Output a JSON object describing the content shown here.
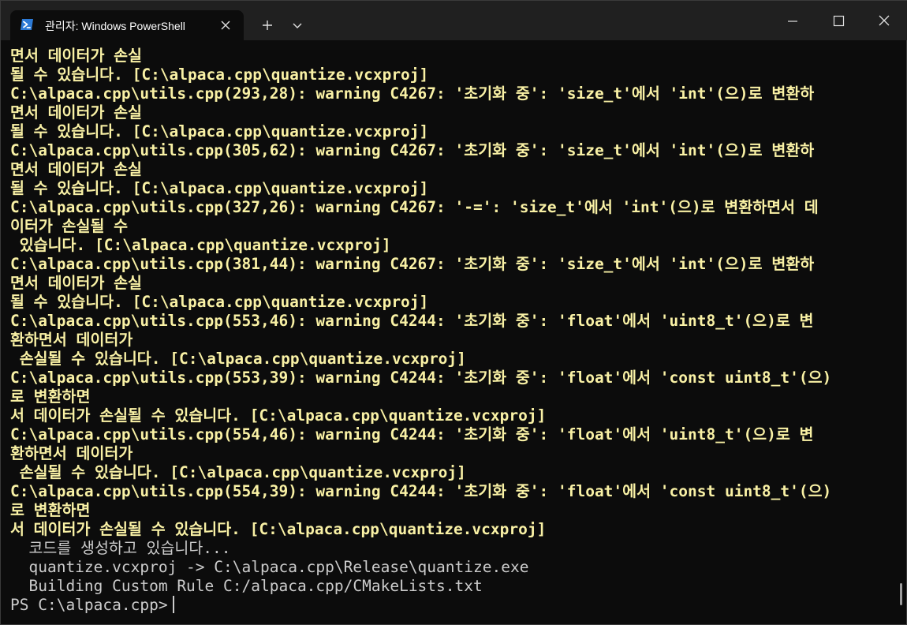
{
  "tab": {
    "title": "관리자: Windows PowerShell",
    "icon": "powershell-icon"
  },
  "titlebar": {
    "new_tab_icon": "plus-icon",
    "dropdown_icon": "chevron-down-icon",
    "minimize_icon": "minimize-icon",
    "maximize_icon": "maximize-icon",
    "close_icon": "close-icon"
  },
  "colors": {
    "background": "#0c0c0c",
    "titlebar": "#202020",
    "warning_text": "#f9f1a5",
    "normal_text": "#cccccc"
  },
  "terminal": {
    "lines": [
      {
        "text": "면서 데이터가 손실",
        "warn": true
      },
      {
        "text": "될 수 있습니다. [C:\\alpaca.cpp\\quantize.vcxproj]",
        "warn": true
      },
      {
        "text": "C:\\alpaca.cpp\\utils.cpp(293,28): warning C4267: '초기화 중': 'size_t'에서 'int'(으)로 변환하",
        "warn": true
      },
      {
        "text": "면서 데이터가 손실",
        "warn": true
      },
      {
        "text": "될 수 있습니다. [C:\\alpaca.cpp\\quantize.vcxproj]",
        "warn": true
      },
      {
        "text": "C:\\alpaca.cpp\\utils.cpp(305,62): warning C4267: '초기화 중': 'size_t'에서 'int'(으)로 변환하",
        "warn": true
      },
      {
        "text": "면서 데이터가 손실",
        "warn": true
      },
      {
        "text": "될 수 있습니다. [C:\\alpaca.cpp\\quantize.vcxproj]",
        "warn": true
      },
      {
        "text": "C:\\alpaca.cpp\\utils.cpp(327,26): warning C4267: '-=': 'size_t'에서 'int'(으)로 변환하면서 데",
        "warn": true
      },
      {
        "text": "이터가 손실될 수",
        "warn": true
      },
      {
        "text": " 있습니다. [C:\\alpaca.cpp\\quantize.vcxproj]",
        "warn": true
      },
      {
        "text": "C:\\alpaca.cpp\\utils.cpp(381,44): warning C4267: '초기화 중': 'size_t'에서 'int'(으)로 변환하",
        "warn": true
      },
      {
        "text": "면서 데이터가 손실",
        "warn": true
      },
      {
        "text": "될 수 있습니다. [C:\\alpaca.cpp\\quantize.vcxproj]",
        "warn": true
      },
      {
        "text": "C:\\alpaca.cpp\\utils.cpp(553,46): warning C4244: '초기화 중': 'float'에서 'uint8_t'(으)로 변",
        "warn": true
      },
      {
        "text": "환하면서 데이터가",
        "warn": true
      },
      {
        "text": " 손실될 수 있습니다. [C:\\alpaca.cpp\\quantize.vcxproj]",
        "warn": true
      },
      {
        "text": "C:\\alpaca.cpp\\utils.cpp(553,39): warning C4244: '초기화 중': 'float'에서 'const uint8_t'(으)",
        "warn": true
      },
      {
        "text": "로 변환하면",
        "warn": true
      },
      {
        "text": "서 데이터가 손실될 수 있습니다. [C:\\alpaca.cpp\\quantize.vcxproj]",
        "warn": true
      },
      {
        "text": "C:\\alpaca.cpp\\utils.cpp(554,46): warning C4244: '초기화 중': 'float'에서 'uint8_t'(으)로 변",
        "warn": true
      },
      {
        "text": "환하면서 데이터가",
        "warn": true
      },
      {
        "text": " 손실될 수 있습니다. [C:\\alpaca.cpp\\quantize.vcxproj]",
        "warn": true
      },
      {
        "text": "C:\\alpaca.cpp\\utils.cpp(554,39): warning C4244: '초기화 중': 'float'에서 'const uint8_t'(으)",
        "warn": true
      },
      {
        "text": "로 변환하면",
        "warn": true
      },
      {
        "text": "서 데이터가 손실될 수 있습니다. [C:\\alpaca.cpp\\quantize.vcxproj]",
        "warn": true
      },
      {
        "text": "  코드를 생성하고 있습니다...",
        "warn": false
      },
      {
        "text": "  quantize.vcxproj -> C:\\alpaca.cpp\\Release\\quantize.exe",
        "warn": false
      },
      {
        "text": "  Building Custom Rule C:/alpaca.cpp/CMakeLists.txt",
        "warn": false
      }
    ],
    "prompt": "PS C:\\alpaca.cpp>"
  }
}
